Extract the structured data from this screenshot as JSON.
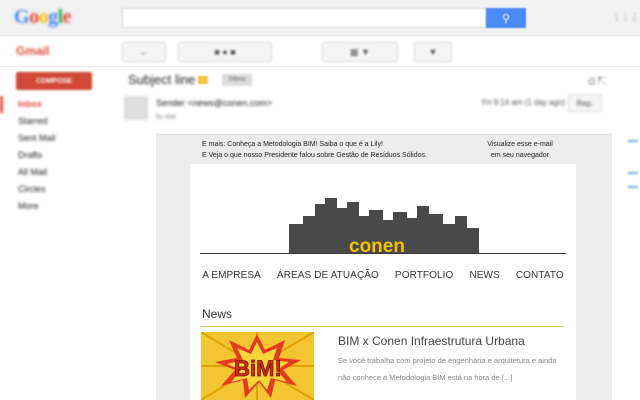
{
  "gmail": {
    "logo": "Google",
    "app_label": "Gmail",
    "compose_label": "COMPOSE",
    "nav_items": [
      "Inbox",
      "Starred",
      "Sent Mail",
      "Drafts",
      "All Mail",
      "Circles",
      "More"
    ],
    "subject": "Subject line",
    "tag_label": "Inbox",
    "sender": "Sender <news@conen.com>",
    "to_line": "to me",
    "date_text": "Fri 9:14 am (1 day ago)",
    "reply_label": "Rep."
  },
  "email": {
    "preheader_left_line1": "E mais: Conheça a Metodologia BIM! Saiba o que é a Lily!",
    "preheader_left_line2": "E Veja o que nosso Presidente falou sobre Gestão de Resíduos Sólidos.",
    "preheader_right_line1": "Visualize esse e-mail",
    "preheader_right_line2": "em seu navegador",
    "brand": "conen",
    "menu": [
      "A EMPRESA",
      "ÁREAS DE ATUAÇÃO",
      "PORTFOLIO",
      "NEWS",
      "CONTATO"
    ],
    "section_title": "News",
    "article": {
      "image_text": "BiM!",
      "title": "BIM x Conen Infraestrutura Urbana",
      "excerpt": "Se você trabalha com projeto de engenharia e arquitetura e ainda não conhece a Metodologia BIM está na hora de [...]"
    }
  },
  "colors": {
    "brand_yellow": "#f5c400",
    "skyline_gray": "#4a4a4a",
    "gmail_red": "#d14836",
    "search_blue": "#4a8af4"
  }
}
